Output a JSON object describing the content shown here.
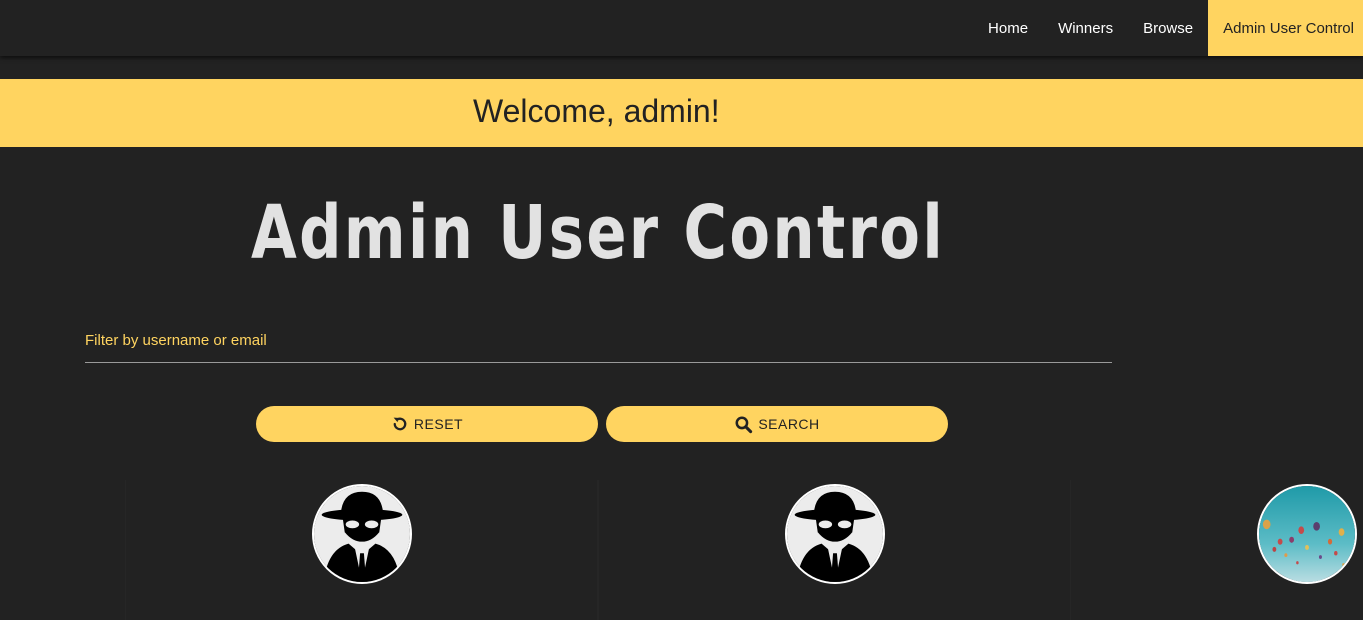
{
  "nav": {
    "items": [
      {
        "label": "Home",
        "active": false
      },
      {
        "label": "Winners",
        "active": false
      },
      {
        "label": "Browse",
        "active": false
      },
      {
        "label": "Admin User Control",
        "active": true
      }
    ]
  },
  "welcome": {
    "text": "Welcome, admin!"
  },
  "page": {
    "title": "Admin User Control"
  },
  "filter": {
    "label": "Filter by username or email",
    "value": ""
  },
  "buttons": {
    "reset_label": "RESET",
    "reset_icon": "reset-icon",
    "search_label": "SEARCH",
    "search_icon": "search-icon"
  },
  "users": [
    {
      "avatar_icon": "spy-icon"
    },
    {
      "avatar_icon": "spy-icon"
    }
  ],
  "profile": {
    "avatar": "hot-air-balloons-image"
  },
  "colors": {
    "background": "#222222",
    "accent": "#ffd460",
    "title": "#e2e2e2",
    "text_dark": "#222222"
  }
}
